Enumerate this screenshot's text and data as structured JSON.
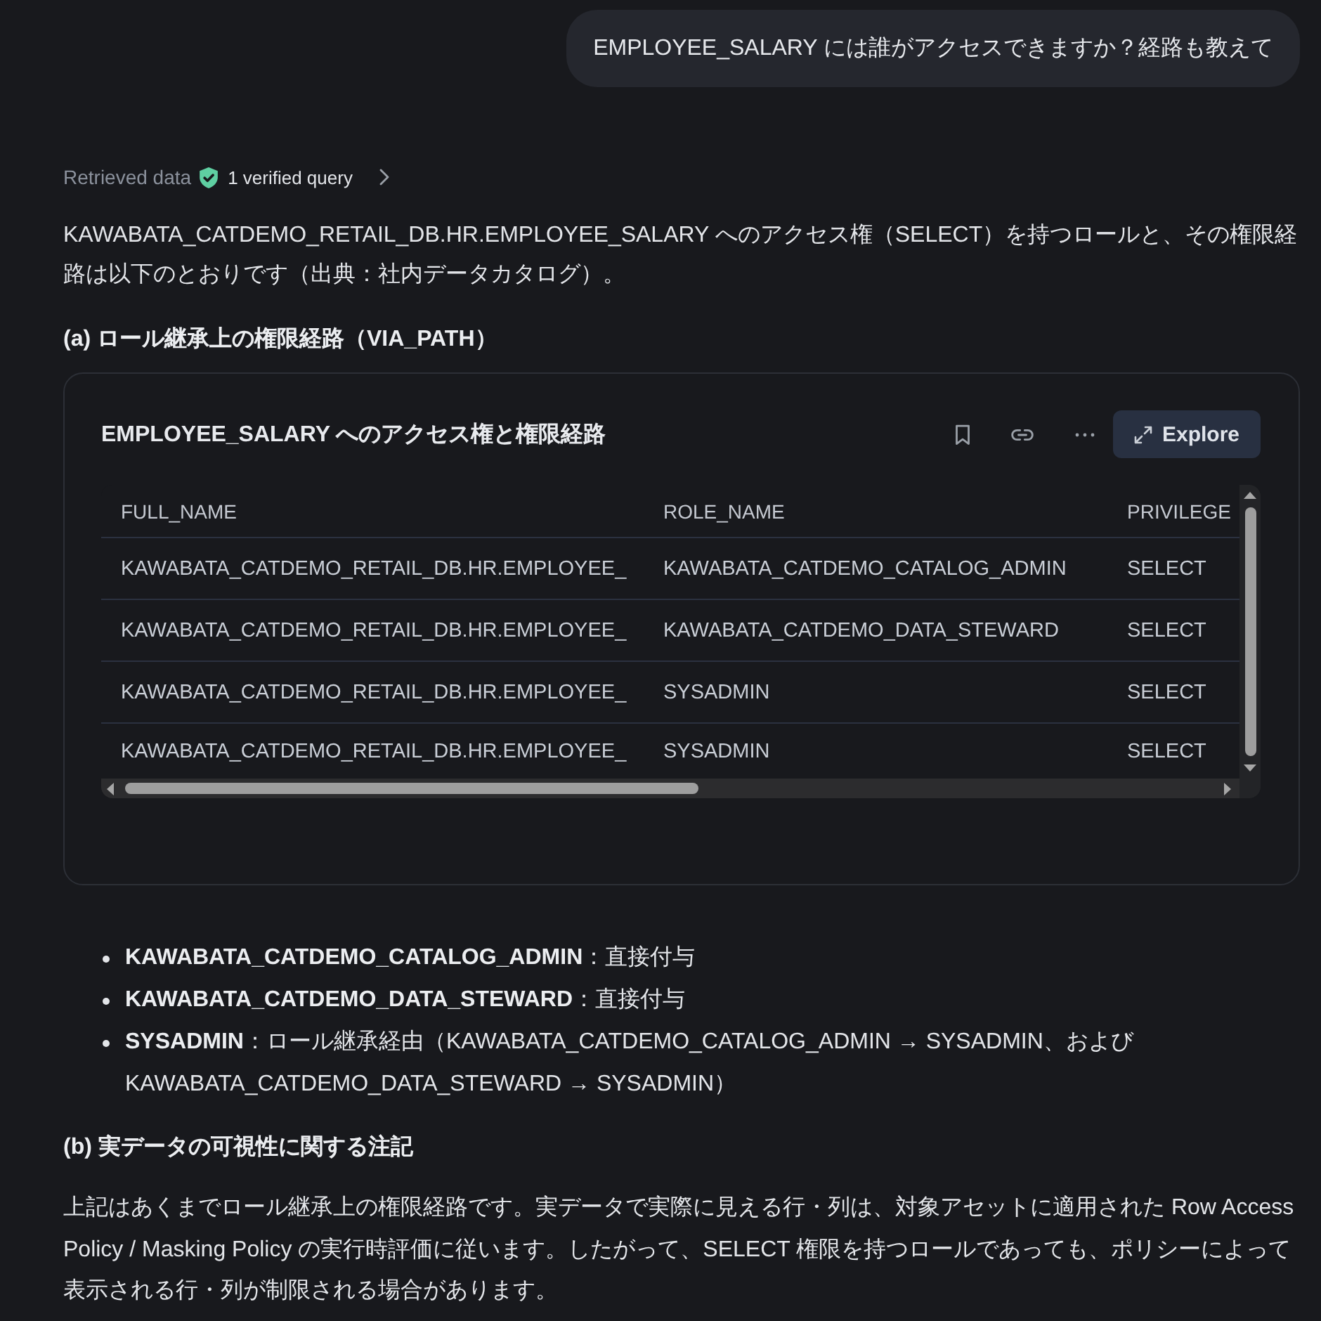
{
  "user_message": {
    "text": "EMPLOYEE_SALARY には誰がアクセスできますか？経路も教えて"
  },
  "retrieved": {
    "label": "Retrieved data",
    "verified": "1 verified query"
  },
  "intro": "KAWABATA_CATDEMO_RETAIL_DB.HR.EMPLOYEE_SALARY へのアクセス権（SELECT）を持つロールと、その権限経路は以下のとおりです（出典：社内データカタログ）。",
  "section_a": {
    "heading": "(a) ロール継承上の権限経路（VIA_PATH）"
  },
  "card": {
    "title": "EMPLOYEE_SALARY へのアクセス権と権限経路",
    "explore": "Explore",
    "table": {
      "columns": [
        "FULL_NAME",
        "ROLE_NAME",
        "PRIVILEGE"
      ],
      "rows": [
        [
          "KAWABATA_CATDEMO_RETAIL_DB.HR.EMPLOYEE_",
          "KAWABATA_CATDEMO_CATALOG_ADMIN",
          "SELECT"
        ],
        [
          "KAWABATA_CATDEMO_RETAIL_DB.HR.EMPLOYEE_",
          "KAWABATA_CATDEMO_DATA_STEWARD",
          "SELECT"
        ],
        [
          "KAWABATA_CATDEMO_RETAIL_DB.HR.EMPLOYEE_",
          "SYSADMIN",
          "SELECT"
        ],
        [
          "KAWABATA_CATDEMO_RETAIL_DB.HR.EMPLOYEE_",
          "SYSADMIN",
          "SELECT"
        ]
      ]
    }
  },
  "bullets": [
    "**KAWABATA_CATDEMO_CATALOG_ADMIN**：直接付与",
    "**KAWABATA_CATDEMO_DATA_STEWARD**：直接付与",
    "**SYSADMIN**：ロール継承経由（KAWABATA_CATDEMO_CATALOG_ADMIN → SYSADMIN、および KAWABATA_CATDEMO_DATA_STEWARD → SYSADMIN）"
  ],
  "section_b": {
    "heading": "(b) 実データの可視性に関する注記",
    "text": "上記はあくまでロール継承上の権限経路です。実データで実際に見える行・列は、対象アセットに適用された Row Access Policy / Masking Policy の実行時評価に従います。したがって、SELECT 権限を持つロールであっても、ポリシーによって表示される行・列が制限される場合があります。"
  }
}
